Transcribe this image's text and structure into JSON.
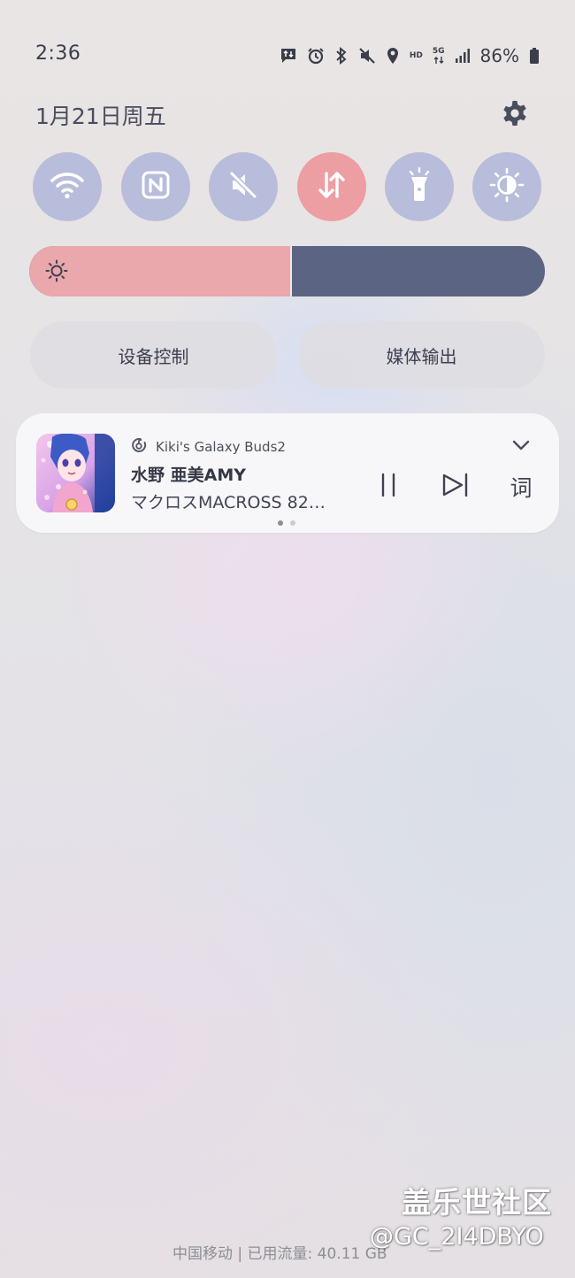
{
  "status_bar": {
    "time": "2:36",
    "network_type_label": "HD",
    "network_gen_label": "5G",
    "battery_percent": "86%",
    "icons": [
      "message-transfer-icon",
      "alarm-icon",
      "bluetooth-icon",
      "mute-icon",
      "location-icon",
      "hd-icon",
      "5g-icon",
      "signal-icon",
      "battery-icon"
    ]
  },
  "header": {
    "date": "1月21日周五",
    "settings_icon": "gear-icon"
  },
  "quick_toggles": [
    {
      "name": "wifi",
      "icon": "wifi-icon",
      "active": false
    },
    {
      "name": "nfc",
      "icon": "nfc-icon",
      "active": false
    },
    {
      "name": "mute",
      "icon": "mute-icon",
      "active": false
    },
    {
      "name": "mobile-data",
      "icon": "data-transfer-icon",
      "active": true
    },
    {
      "name": "flashlight",
      "icon": "flashlight-icon",
      "active": false
    },
    {
      "name": "eye-comfort",
      "icon": "eye-comfort-icon",
      "active": false
    }
  ],
  "brightness": {
    "level": 0.51,
    "icon": "sun-icon"
  },
  "buttons": {
    "device_control": "设备控制",
    "media_output": "媒体输出"
  },
  "media": {
    "app_icon": "netease-music-icon",
    "output_device": "Kiki's Galaxy Buds2",
    "title": "水野 亜美AMY",
    "subtitle": "マクロスMACROSS 82…",
    "lyrics_label": "词",
    "page_count": 2,
    "current_page": 1
  },
  "footer": {
    "carrier_status": "中国移动 | 已用流量: 40.11 GB"
  },
  "watermark": {
    "line1": "盖乐世社区",
    "line2": "@GC_2I4DBYO"
  },
  "colors": {
    "toggle_inactive": "#b8bddb",
    "toggle_active": "#ec9ea3",
    "brightness_fill": "#eaa7ac",
    "brightness_track": "#5b6482",
    "icon_white": "#ffffff"
  }
}
